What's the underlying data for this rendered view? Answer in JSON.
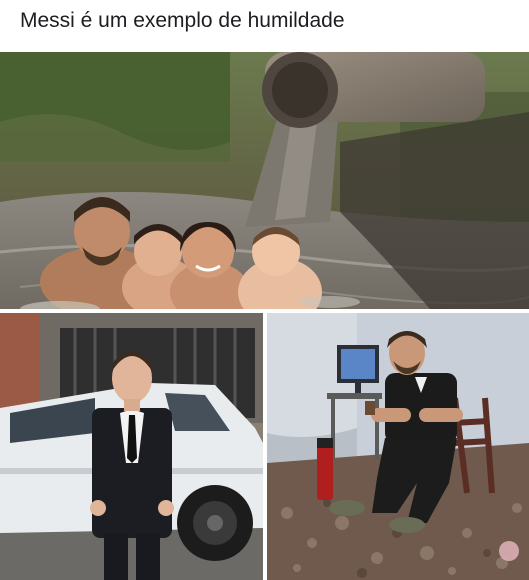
{
  "post": {
    "caption": "Messi é um exemplo de humildade"
  },
  "images": [
    {
      "name": "family-in-sewage-river-photo"
    },
    {
      "name": "man-in-suit-beside-white-car-photo"
    },
    {
      "name": "man-seated-in-rubble-room-photo"
    }
  ]
}
